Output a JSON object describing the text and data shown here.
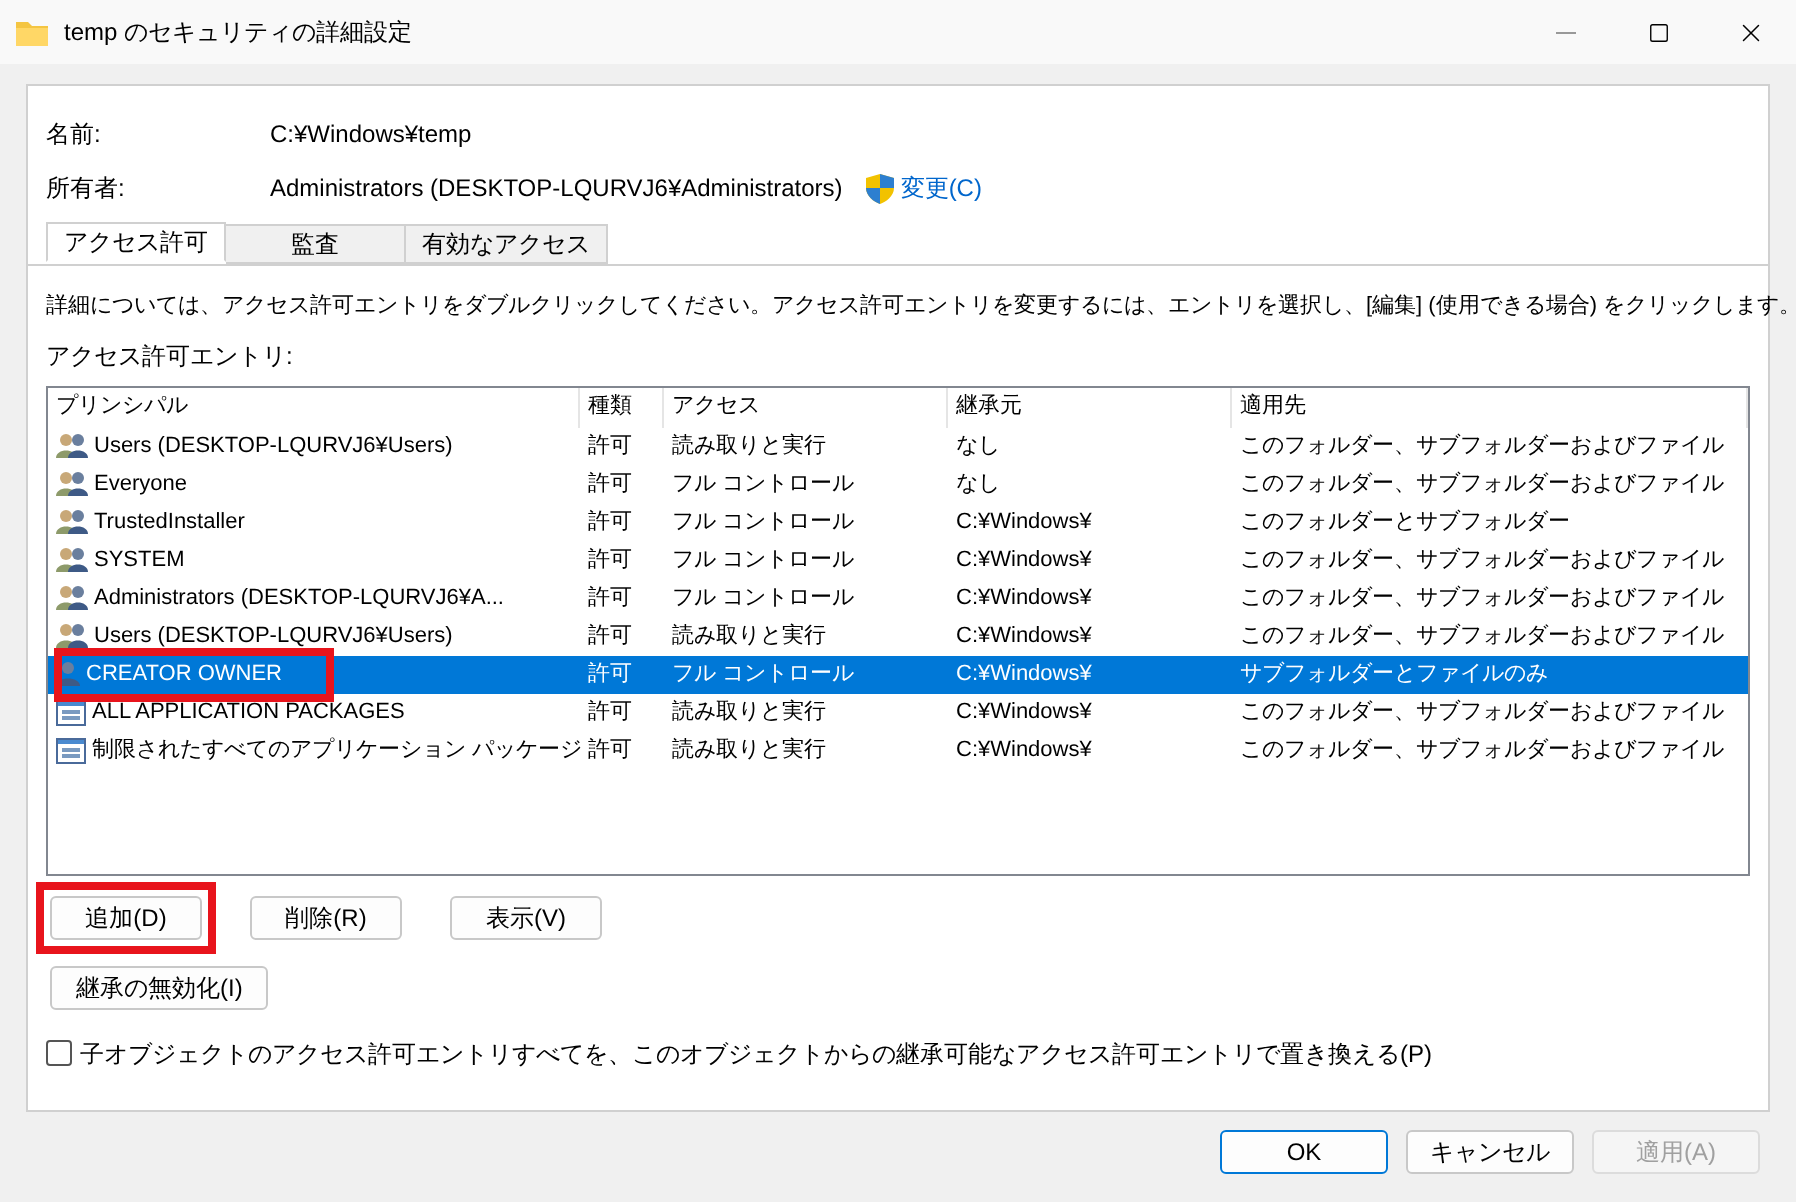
{
  "window": {
    "title": "temp のセキュリティの詳細設定"
  },
  "name_field": {
    "label": "名前:",
    "value": "C:¥Windows¥temp"
  },
  "owner_field": {
    "label": "所有者:",
    "value": "Administrators (DESKTOP-LQURVJ6¥Administrators)",
    "link": "変更(C)"
  },
  "tabs": [
    {
      "label": "アクセス許可",
      "selected": true
    },
    {
      "label": "監査",
      "selected": false
    },
    {
      "label": "有効なアクセス",
      "selected": false
    }
  ],
  "instructions": "詳細については、アクセス許可エントリをダブルクリックしてください。アクセス許可エントリを変更するには、エントリを選択し、[編集] (使用できる場合) をクリックします。",
  "list_label": "アクセス許可エントリ:",
  "table": {
    "columns": [
      "プリンシパル",
      "種類",
      "アクセス",
      "継承元",
      "適用先"
    ],
    "rows": [
      {
        "kind": "group",
        "principal": "Users (DESKTOP-LQURVJ6¥Users)",
        "type": "許可",
        "access": "読み取りと実行",
        "inherited_from": "なし",
        "applies_to": "このフォルダー、サブフォルダーおよびファイル",
        "selected": false,
        "highlighted": false
      },
      {
        "kind": "group",
        "principal": "Everyone",
        "type": "許可",
        "access": "フル コントロール",
        "inherited_from": "なし",
        "applies_to": "このフォルダー、サブフォルダーおよびファイル",
        "selected": false,
        "highlighted": false
      },
      {
        "kind": "group",
        "principal": "TrustedInstaller",
        "type": "許可",
        "access": "フル コントロール",
        "inherited_from": "C:¥Windows¥",
        "applies_to": "このフォルダーとサブフォルダー",
        "selected": false,
        "highlighted": false
      },
      {
        "kind": "group",
        "principal": "SYSTEM",
        "type": "許可",
        "access": "フル コントロール",
        "inherited_from": "C:¥Windows¥",
        "applies_to": "このフォルダー、サブフォルダーおよびファイル",
        "selected": false,
        "highlighted": false
      },
      {
        "kind": "group",
        "principal": "Administrators (DESKTOP-LQURVJ6¥A...",
        "type": "許可",
        "access": "フル コントロール",
        "inherited_from": "C:¥Windows¥",
        "applies_to": "このフォルダー、サブフォルダーおよびファイル",
        "selected": false,
        "highlighted": false
      },
      {
        "kind": "group",
        "principal": "Users (DESKTOP-LQURVJ6¥Users)",
        "type": "許可",
        "access": "読み取りと実行",
        "inherited_from": "C:¥Windows¥",
        "applies_to": "このフォルダー、サブフォルダーおよびファイル",
        "selected": false,
        "highlighted": false
      },
      {
        "kind": "user",
        "principal": "CREATOR OWNER",
        "type": "許可",
        "access": "フル コントロール",
        "inherited_from": "C:¥Windows¥",
        "applies_to": "サブフォルダーとファイルのみ",
        "selected": true,
        "highlighted": true
      },
      {
        "kind": "package",
        "principal": "ALL APPLICATION PACKAGES",
        "type": "許可",
        "access": "読み取りと実行",
        "inherited_from": "C:¥Windows¥",
        "applies_to": "このフォルダー、サブフォルダーおよびファイル",
        "selected": false,
        "highlighted": false
      },
      {
        "kind": "package",
        "principal": "制限されたすべてのアプリケーション パッケージ",
        "type": "許可",
        "access": "読み取りと実行",
        "inherited_from": "C:¥Windows¥",
        "applies_to": "このフォルダー、サブフォルダーおよびファイル",
        "selected": false,
        "highlighted": false
      }
    ]
  },
  "buttons": [
    {
      "label": "追加(D)",
      "highlighted": true
    },
    {
      "label": "削除(R)",
      "highlighted": false
    },
    {
      "label": "表示(V)",
      "highlighted": false
    }
  ],
  "disable_inheritance_button": "継承の無効化(I)",
  "replace_checkbox": {
    "label": "子オブジェクトのアクセス許可エントリすべてを、このオブジェクトからの継承可能なアクセス許可エントリで置き換える(P)",
    "checked": false
  },
  "dialog_buttons": [
    {
      "label": "OK",
      "default": true,
      "disabled": false
    },
    {
      "label": "キャンセル",
      "default": false,
      "disabled": false
    },
    {
      "label": "適用(A)",
      "default": false,
      "disabled": true
    }
  ]
}
